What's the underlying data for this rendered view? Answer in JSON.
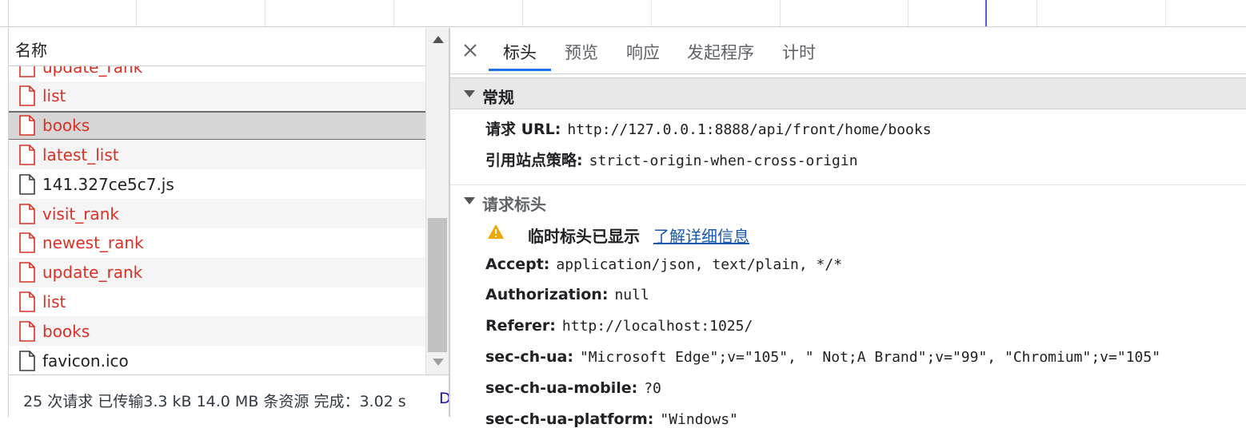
{
  "list": {
    "header_label": "名称",
    "rows": [
      {
        "name": "update_rank",
        "status": "err"
      },
      {
        "name": "list",
        "status": "err"
      },
      {
        "name": "books",
        "status": "err",
        "selected": true
      },
      {
        "name": "latest_list",
        "status": "err"
      },
      {
        "name": "141.327ce5c7.js",
        "status": "ok"
      },
      {
        "name": "visit_rank",
        "status": "err"
      },
      {
        "name": "newest_rank",
        "status": "err"
      },
      {
        "name": "update_rank",
        "status": "err"
      },
      {
        "name": "list",
        "status": "err"
      },
      {
        "name": "books",
        "status": "err"
      },
      {
        "name": "favicon.ico",
        "status": "ok"
      }
    ]
  },
  "status_bar": {
    "summary": "25 次请求  已传输3.3 kB  14.0 MB 条资源  完成：3.02 s",
    "overflow": "D"
  },
  "tabs": [
    {
      "label": "标头",
      "active": true
    },
    {
      "label": "预览"
    },
    {
      "label": "响应"
    },
    {
      "label": "发起程序"
    },
    {
      "label": "计时"
    }
  ],
  "general": {
    "title": "常规",
    "request_url_key": "请求 URL:",
    "request_url_value": "http://127.0.0.1:8888/api/front/home/books",
    "referrer_policy_key": "引用站点策略:",
    "referrer_policy_value": "strict-origin-when-cross-origin"
  },
  "request_headers": {
    "title": "请求标头",
    "warning_text": "临时标头已显示",
    "warning_link": "了解详细信息",
    "items": [
      {
        "key": "Accept:",
        "value": "application/json, text/plain, */*"
      },
      {
        "key": "Authorization:",
        "value": "null"
      },
      {
        "key": "Referer:",
        "value": "http://localhost:1025/"
      },
      {
        "key": "sec-ch-ua:",
        "value": "\"Microsoft Edge\";v=\"105\", \" Not;A Brand\";v=\"99\", \"Chromium\";v=\"105\""
      },
      {
        "key": "sec-ch-ua-mobile:",
        "value": "?0"
      },
      {
        "key": "sec-ch-ua-platform:",
        "value": "\"Windows\""
      }
    ]
  },
  "colors": {
    "error_text": "#d93025",
    "tab_accent": "#1a73e8",
    "link": "#1a57b0",
    "timeline_marker": "#5561c8"
  }
}
